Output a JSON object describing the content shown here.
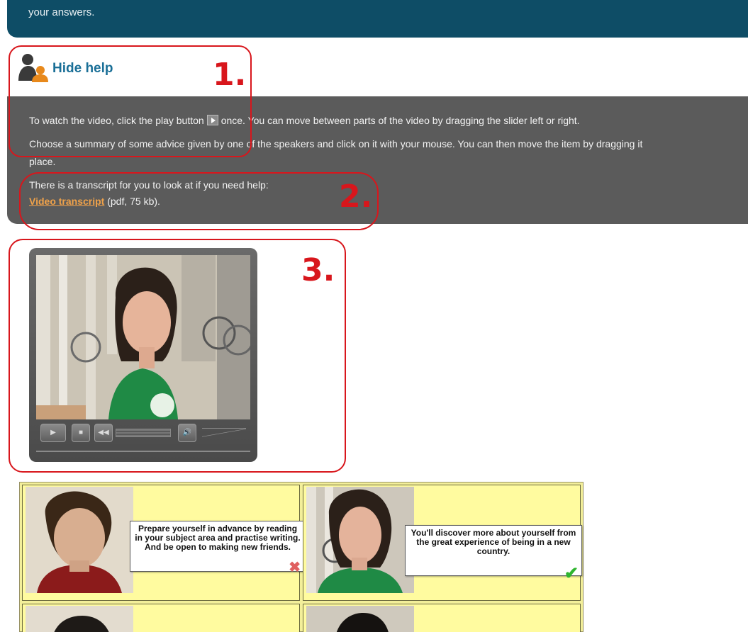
{
  "banner": {
    "text": "your answers."
  },
  "help": {
    "toggle_label": "Hide help",
    "line1_before": "To watch the video, click the play button",
    "line1_after": "once. You can move between parts of the video by dragging the slider left or right.",
    "line2": "Choose a summary of some advice given by one of the speakers and click on it with your mouse. You can then move the item by dragging it",
    "line2_wrap": "place.",
    "line3": "There is a transcript for you to look at if you need help:",
    "transcript_link": "Video transcript",
    "transcript_meta": "(pdf, 75 kb)."
  },
  "annotations": [
    "1.",
    "2.",
    "3."
  ],
  "activity": {
    "cards": [
      {
        "text": "Prepare yourself in advance by reading in your subject area and practise writing. And be open to making new friends.",
        "status": "incorrect"
      },
      {
        "text": "You'll discover more about yourself from the great experience of being in a new country.",
        "status": "correct"
      }
    ]
  },
  "colors": {
    "banner": "#0e4d66",
    "help_panel": "#5b5b5b",
    "help_link": "#1a6f97",
    "transcript_link": "#f0a24a",
    "annotation": "#d8161c",
    "grid_cell": "#fffb9f",
    "correct": "#2fb52f",
    "incorrect": "#e06060"
  },
  "icons": {
    "help": "person-help-icon",
    "play": "play-icon",
    "stop": "stop-icon",
    "rewind": "rewind-icon",
    "volume": "volume-icon",
    "correct": "check-icon",
    "incorrect": "cross-icon"
  }
}
